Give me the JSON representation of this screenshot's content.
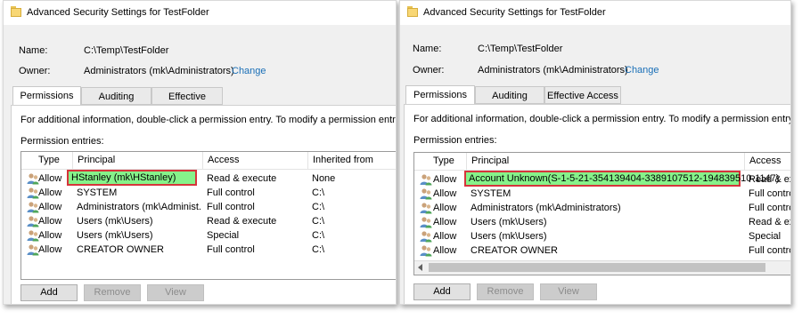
{
  "left": {
    "title": "Advanced Security Settings for TestFolder",
    "name_label": "Name:",
    "name_value": "C:\\Temp\\TestFolder",
    "owner_label": "Owner:",
    "owner_value": "Administrators (mk\\Administrators)",
    "change_link": "Change",
    "tabs": [
      "Permissions",
      "Auditing",
      "Effective Access"
    ],
    "info": "For additional information, double-click a permission entry. To modify a permission entry, select",
    "entries_label": "Permission entries:",
    "columns": [
      "Type",
      "Principal",
      "Access",
      "Inherited from"
    ],
    "rows": [
      {
        "type": "Allow",
        "principal": "HStanley (mk\\HStanley)",
        "access": "Read & execute",
        "inherited": "None"
      },
      {
        "type": "Allow",
        "principal": "SYSTEM",
        "access": "Full control",
        "inherited": "C:\\"
      },
      {
        "type": "Allow",
        "principal": "Administrators (mk\\Administ...",
        "access": "Full control",
        "inherited": "C:\\"
      },
      {
        "type": "Allow",
        "principal": "Users (mk\\Users)",
        "access": "Read & execute",
        "inherited": "C:\\"
      },
      {
        "type": "Allow",
        "principal": "Users (mk\\Users)",
        "access": "Special",
        "inherited": "C:\\"
      },
      {
        "type": "Allow",
        "principal": "CREATOR OWNER",
        "access": "Full control",
        "inherited": "C:\\"
      }
    ],
    "buttons": {
      "add": "Add",
      "remove": "Remove",
      "view": "View"
    }
  },
  "right": {
    "title": "Advanced Security Settings for TestFolder",
    "name_label": "Name:",
    "name_value": "C:\\Temp\\TestFolder",
    "owner_label": "Owner:",
    "owner_value": "Administrators (mk\\Administrators)",
    "change_link": "Change",
    "tabs": [
      "Permissions",
      "Auditing",
      "Effective Access"
    ],
    "info": "For additional information, double-click a permission entry. To modify a permission entry, select t",
    "entries_label": "Permission entries:",
    "columns": [
      "Type",
      "Principal",
      "Access"
    ],
    "rows": [
      {
        "type": "Allow",
        "principal": "Account Unknown(S-1-5-21-354139404-3389107512-194839510-1147)",
        "access": "Read & exe"
      },
      {
        "type": "Allow",
        "principal": "SYSTEM",
        "access": "Full control"
      },
      {
        "type": "Allow",
        "principal": "Administrators (mk\\Administrators)",
        "access": "Full control"
      },
      {
        "type": "Allow",
        "principal": "Users (mk\\Users)",
        "access": "Read & exe"
      },
      {
        "type": "Allow",
        "principal": "Users (mk\\Users)",
        "access": "Special"
      },
      {
        "type": "Allow",
        "principal": "CREATOR OWNER",
        "access": "Full control"
      }
    ],
    "buttons": {
      "add": "Add",
      "remove": "Remove",
      "view": "View"
    }
  },
  "colors": {
    "highlight_fill": "#86f28a",
    "highlight_border": "#d6343b",
    "link": "#1a6fb7"
  }
}
